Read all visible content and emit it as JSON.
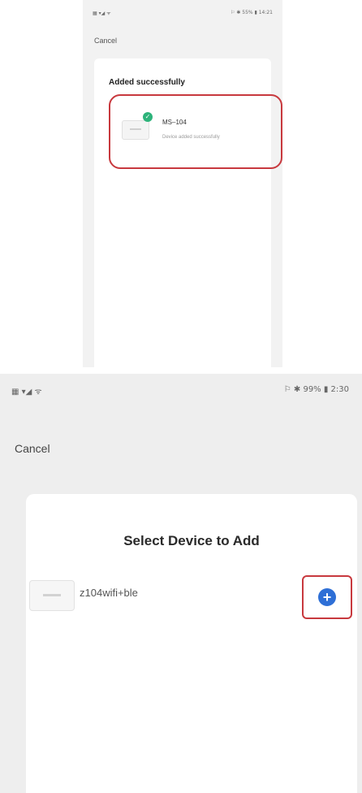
{
  "top_screen": {
    "status_left": "▦ ▾◢ ᯤ",
    "status_right": "⚐ ✱ 55% ▮ 14:21",
    "cancel_label": "Cancel",
    "title": "Added successfully",
    "device": {
      "name": "MS–104",
      "status": "Device added successfully"
    }
  },
  "bottom_screen": {
    "status_left": "▦ ▾◢ ᯤ",
    "status_right": "⚐ ✱ 99% ▮ 2:30",
    "cancel_label": "Cancel",
    "title": "Select Device to Add",
    "device": {
      "name": "z104wifi+ble",
      "add_glyph": "+"
    }
  },
  "colors": {
    "highlight_border": "#c8393e",
    "success_green": "#2db37a",
    "add_blue": "#2e6fd6"
  }
}
